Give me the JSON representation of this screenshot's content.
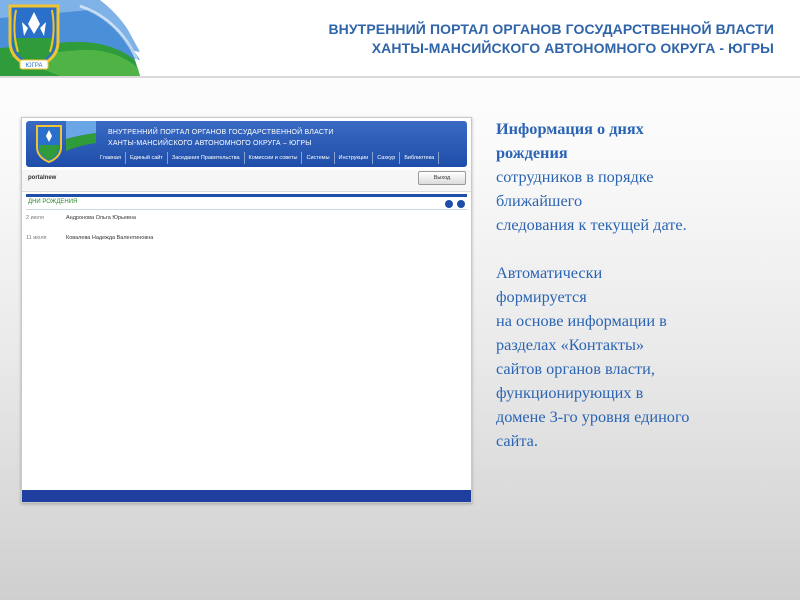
{
  "header": {
    "title_line1": "ВНУТРЕННИЙ ПОРТАЛ ОРГАНОВ ГОСУДАРСТВЕННОЙ ВЛАСТИ",
    "title_line2": "ХАНТЫ-МАНСИЙСКОГО АВТОНОМНОГО ОКРУГА - ЮГРЫ",
    "emblem_label": "ЮГРА",
    "colors": {
      "title": "#2f64a8",
      "flag_blue": "#4a8fd8",
      "flag_green": "#2f9b3a"
    }
  },
  "screenshot": {
    "banner_line1": "ВНУТРЕННИЙ ПОРТАЛ ОРГАНОВ ГОСУДАРСТВЕННОЙ ВЛАСТИ",
    "banner_line2": "ХАНТЫ-МАНСИЙСКОГО АВТОНОМНОГО ОКРУГА – ЮГРЫ",
    "nav": [
      "Главная",
      "Единый сайт",
      "Заседания Правительства",
      "Комиссии и советы",
      "Системы",
      "Инструкции",
      "Сахкур",
      "Библиотека"
    ],
    "site_name": "portalnew",
    "exit_button": "Выход",
    "section_title": "ДНИ РОЖДЕНИЯ",
    "rows": [
      {
        "date": "2 июля",
        "name": "Андронова Ольга Юрьевна"
      },
      {
        "date": "11 июля",
        "name": "Ковалева Надежда Валентиновна"
      }
    ],
    "colors": {
      "banner": "#1e4ea9",
      "section_title": "#2e8b2e"
    }
  },
  "description": {
    "p1_bold_line1": "Информация о днях",
    "p1_bold_line2": "рождения",
    "p1_line3": "сотрудников в порядке",
    "p1_line4": "ближайшего",
    "p1_line5": "следования к текущей дате.",
    "p2_line1": "Автоматически",
    "p2_line2": "формируется",
    "p2_line3": "на основе информации в",
    "p2_line4": "разделах «Контакты»",
    "p2_line5": "сайтов органов власти,",
    "p2_line6": "функционирующих в",
    "p2_line7": "домене 3-го уровня единого",
    "p2_line8": "сайта.",
    "color": "#2a64b3"
  }
}
